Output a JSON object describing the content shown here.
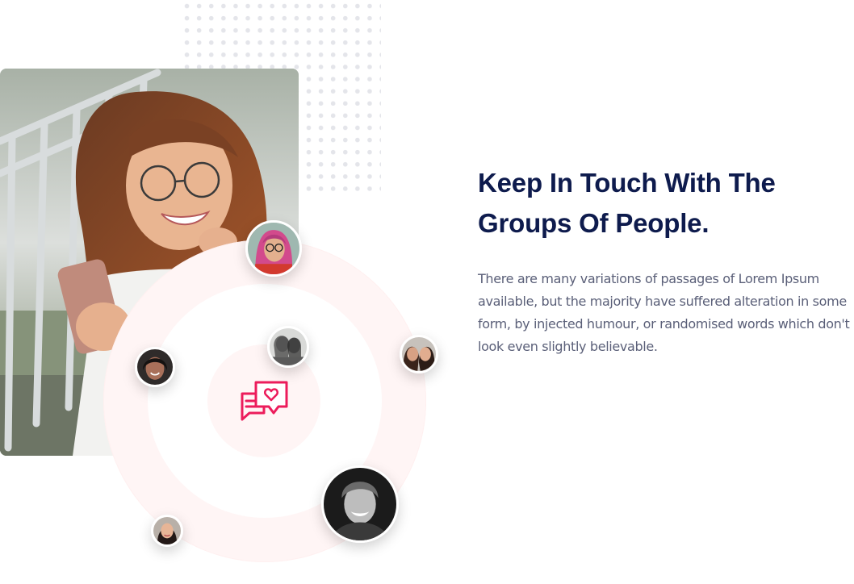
{
  "section": {
    "headline_line1": "Keep In Touch With The",
    "headline_line2": "Groups Of People.",
    "body": "There are many variations of passages of Lorem Ipsum available, but the majority have suffered alteration in some form, by injected humour, or randomised words which don't look even slightly believable."
  },
  "colors": {
    "headline": "#0e1b4d",
    "body_text": "#5a5f78",
    "accent": "#ec1c5b",
    "ring_tint": "#fff5f5"
  },
  "icons": {
    "center": "chat-heart-icon"
  }
}
